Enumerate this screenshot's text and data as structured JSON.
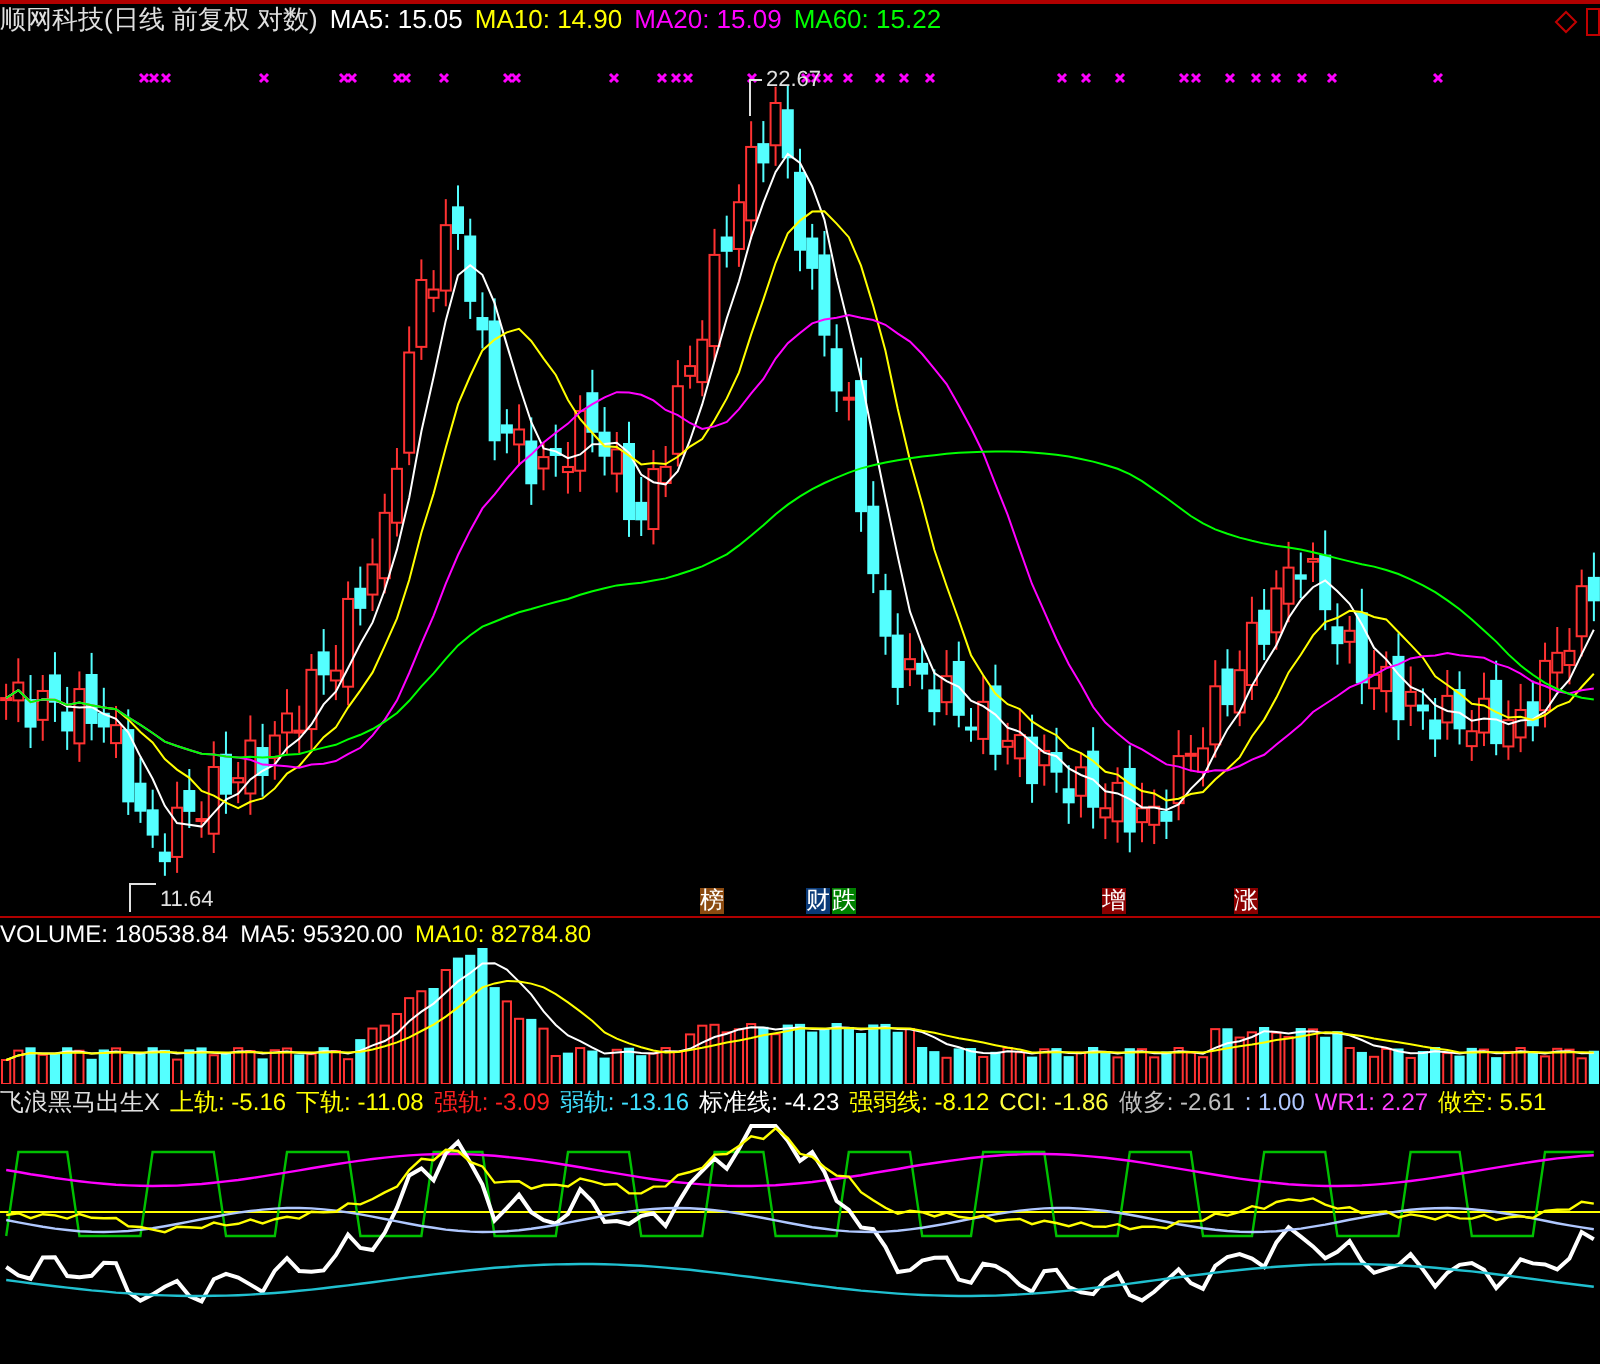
{
  "header": {
    "title": "顺网科技(日线 前复权 对数)",
    "indicators": [
      {
        "text": "MA5: 15.05",
        "color": "#ffffff"
      },
      {
        "text": "MA10: 14.90",
        "color": "#ffff00"
      },
      {
        "text": "MA20: 15.09",
        "color": "#ff00ff"
      },
      {
        "text": "MA60: 15.22",
        "color": "#00ff00"
      }
    ]
  },
  "price_chart": {
    "high_label": "22.67",
    "low_label": "11.64",
    "events": [
      {
        "text": "榜",
        "color": "#8b4a10"
      },
      {
        "text": "财",
        "color": "#0a3a78"
      },
      {
        "text": "跌",
        "color": "#008000"
      },
      {
        "text": "增",
        "color": "#8b0000"
      },
      {
        "text": "涨",
        "color": "#8b0000"
      }
    ]
  },
  "volume": {
    "indicators": [
      {
        "text": "VOLUME: 180538.84",
        "color": "#ffffff"
      },
      {
        "text": "MA5: 95320.00",
        "color": "#ffffff"
      },
      {
        "text": "MA10: 82784.80",
        "color": "#ffff00"
      }
    ]
  },
  "oscillator": {
    "name": "飞浪黑马出生X",
    "indicators": [
      {
        "text": "上轨: -5.16",
        "color": "#ffff00"
      },
      {
        "text": "下轨: -11.08",
        "color": "#ffff00"
      },
      {
        "text": "强轨: -3.09",
        "color": "#ff2020"
      },
      {
        "text": "弱轨: -13.16",
        "color": "#40e0ff"
      },
      {
        "text": "标准线: -4.23",
        "color": "#ffffff"
      },
      {
        "text": "强弱线: -8.12",
        "color": "#ffff00"
      },
      {
        "text": "CCI: -1.86",
        "color": "#ffff40"
      },
      {
        "text": "做多: -2.61",
        "color": "#c0c0c0"
      },
      {
        "text": ": 1.00",
        "color": "#b0c8ff"
      },
      {
        "text": "WR1: 2.27",
        "color": "#ff40ff"
      },
      {
        "text": "做空: 5.51",
        "color": "#ffff00"
      }
    ]
  }
}
